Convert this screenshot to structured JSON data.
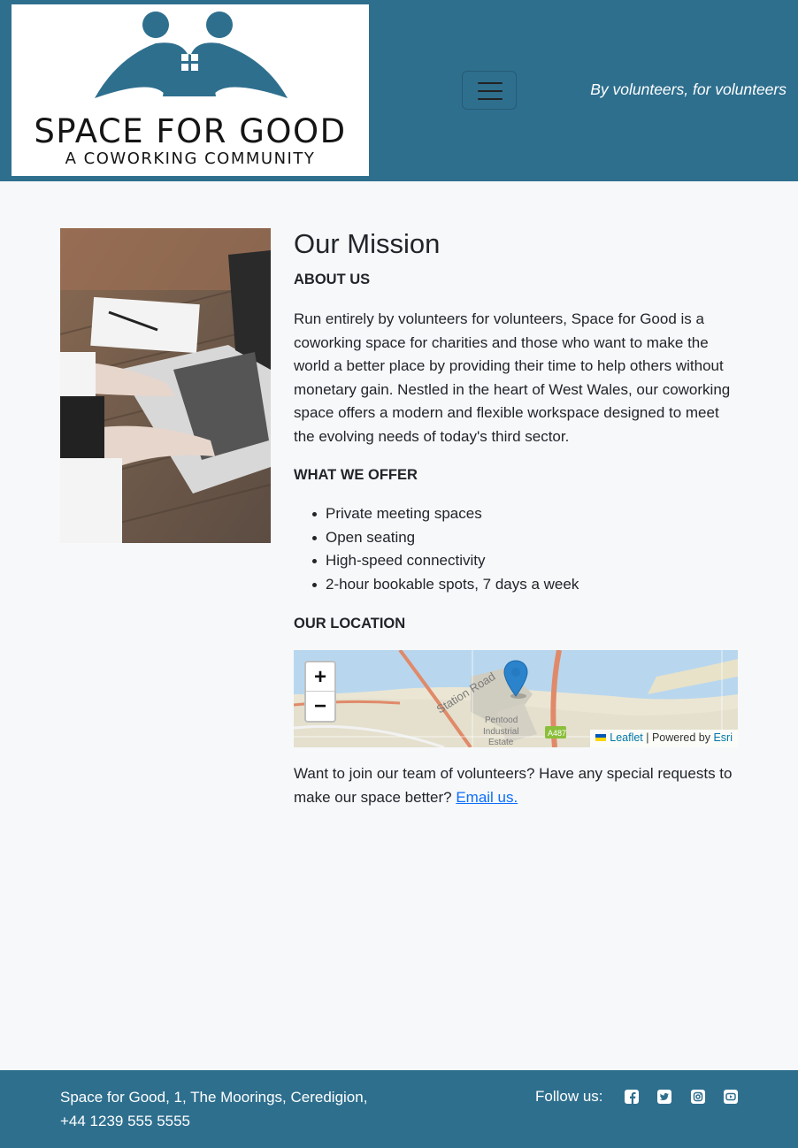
{
  "header": {
    "logo": {
      "name": "SPACE FOR GOOD",
      "subtitle": "A COWORKING COMMUNITY",
      "color": "#2e6f8e"
    },
    "tagline": "By volunteers, for volunteers",
    "menu_icon": "hamburger-icon"
  },
  "main": {
    "title": "Our Mission",
    "about": {
      "heading": "ABOUT US",
      "text": "Run entirely by volunteers for volunteers, Space for Good is a coworking space for charities and those who want to make the world a better place by providing their time to help others without monetary gain. Nestled in the heart of West Wales, our coworking space offers a modern and flexible workspace designed to meet the evolving needs of today's third sector."
    },
    "offer": {
      "heading": "WHAT WE OFFER",
      "items": [
        "Private meeting spaces",
        "Open seating",
        "High-speed connectivity",
        "2-hour bookable spots, 7 days a week"
      ]
    },
    "location": {
      "heading": "OUR LOCATION",
      "map": {
        "zoom_in": "+",
        "zoom_out": "−",
        "labels": [
          "Station Road",
          "Pentood",
          "Industrial",
          "Estate",
          "A487"
        ],
        "attribution": {
          "leaflet": "Leaflet",
          "separator": " | Powered by ",
          "esri": "Esri"
        }
      }
    },
    "join": {
      "text": "Want to join our team of volunteers? Have any special requests to make our space better? ",
      "link": "Email us."
    }
  },
  "footer": {
    "address_line1": "Space for Good, 1, The Moorings, Ceredigion,",
    "address_line2": "+44 1239 555 5555",
    "follow": "Follow us:",
    "social_icons": [
      "facebook-icon",
      "twitter-icon",
      "instagram-icon",
      "youtube-icon"
    ]
  },
  "colors": {
    "brand": "#2e6f8e",
    "link": "#0d6efd",
    "page_bg": "#f7f8fa"
  }
}
